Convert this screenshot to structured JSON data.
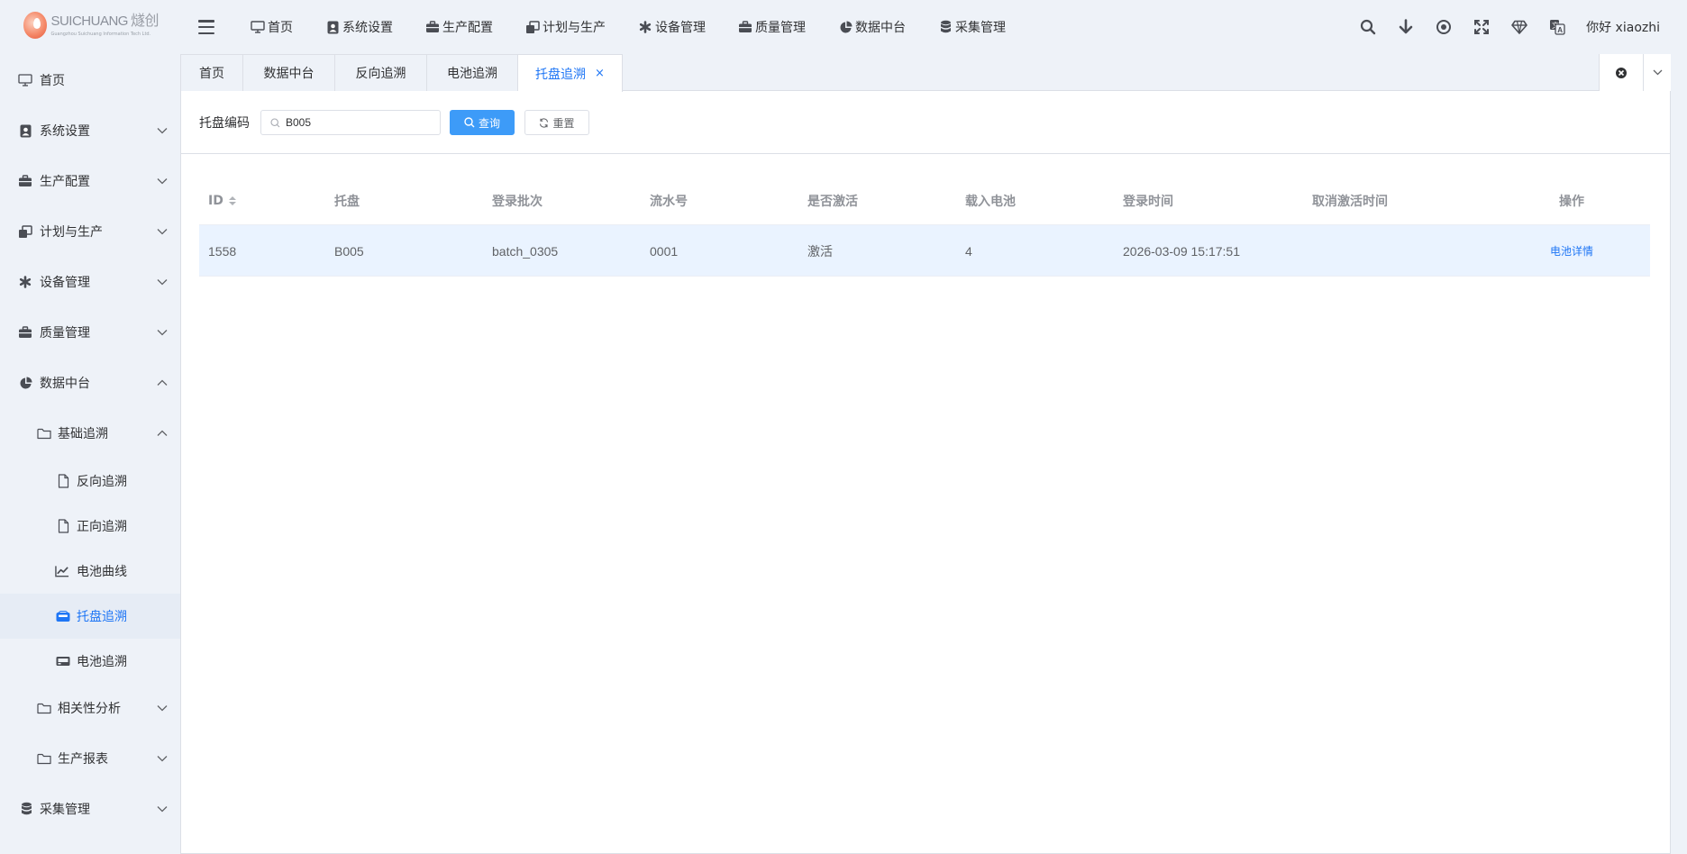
{
  "brand": {
    "name_en": "SUICHUANG",
    "name_cn": "燧创",
    "subtitle": "Guangzhou Suichuang Information Tech Ltd."
  },
  "topnav": {
    "items": [
      {
        "label": "首页",
        "icon": "monitor-icon"
      },
      {
        "label": "系统设置",
        "icon": "user-badge-icon"
      },
      {
        "label": "生产配置",
        "icon": "briefcase-icon"
      },
      {
        "label": "计划与生产",
        "icon": "clone-icon"
      },
      {
        "label": "设备管理",
        "icon": "asterisk-icon"
      },
      {
        "label": "质量管理",
        "icon": "briefcase-icon"
      },
      {
        "label": "数据中台",
        "icon": "pie-chart-icon"
      },
      {
        "label": "采集管理",
        "icon": "database-icon"
      }
    ]
  },
  "header_right": {
    "icons": [
      "search-icon",
      "download-icon",
      "target-icon",
      "fullscreen-icon",
      "diamond-icon",
      "translate-icon"
    ],
    "greeting": "你好 xiaozhi"
  },
  "sidebar": {
    "items": [
      {
        "label": "首页",
        "icon": "monitor-icon"
      },
      {
        "label": "系统设置",
        "icon": "user-badge-icon"
      },
      {
        "label": "生产配置",
        "icon": "briefcase-icon"
      },
      {
        "label": "计划与生产",
        "icon": "clone-icon"
      },
      {
        "label": "设备管理",
        "icon": "asterisk-icon"
      },
      {
        "label": "质量管理",
        "icon": "briefcase-icon"
      },
      {
        "label": "数据中台",
        "icon": "pie-chart-icon"
      },
      {
        "label": "基础追溯",
        "icon": "folder-icon"
      },
      {
        "label": "反向追溯",
        "icon": "file-icon"
      },
      {
        "label": "正向追溯",
        "icon": "file-icon"
      },
      {
        "label": "电池曲线",
        "icon": "line-chart-icon"
      },
      {
        "label": "托盘追溯",
        "icon": "tray-icon"
      },
      {
        "label": "电池追溯",
        "icon": "battery-icon"
      },
      {
        "label": "相关性分析",
        "icon": "folder-icon"
      },
      {
        "label": "生产报表",
        "icon": "folder-icon"
      },
      {
        "label": "采集管理",
        "icon": "database-icon"
      }
    ]
  },
  "tabs": [
    {
      "label": "首页"
    },
    {
      "label": "数据中台"
    },
    {
      "label": "反向追溯"
    },
    {
      "label": "电池追溯"
    },
    {
      "label": "托盘追溯",
      "close": "×"
    }
  ],
  "search": {
    "label": "托盘编码",
    "value": "B005",
    "query_button": "查询",
    "reset_button": "重置"
  },
  "table": {
    "columns": [
      "ID",
      "托盘",
      "登录批次",
      "流水号",
      "是否激活",
      "载入电池",
      "登录时间",
      "取消激活时间",
      "操作"
    ],
    "rows": [
      {
        "id": "1558",
        "tray": "B005",
        "batch": "batch_0305",
        "serial": "0001",
        "active": "激活",
        "batteries": "4",
        "login_time": "2026-03-09 15:17:51",
        "deactivate_time": "",
        "action": "电池详情"
      }
    ]
  },
  "colors": {
    "accent": "#1f76f5",
    "primary_button": "#3d9bf8",
    "background": "#eef2f8",
    "row_highlight": "#eaf3ff"
  }
}
